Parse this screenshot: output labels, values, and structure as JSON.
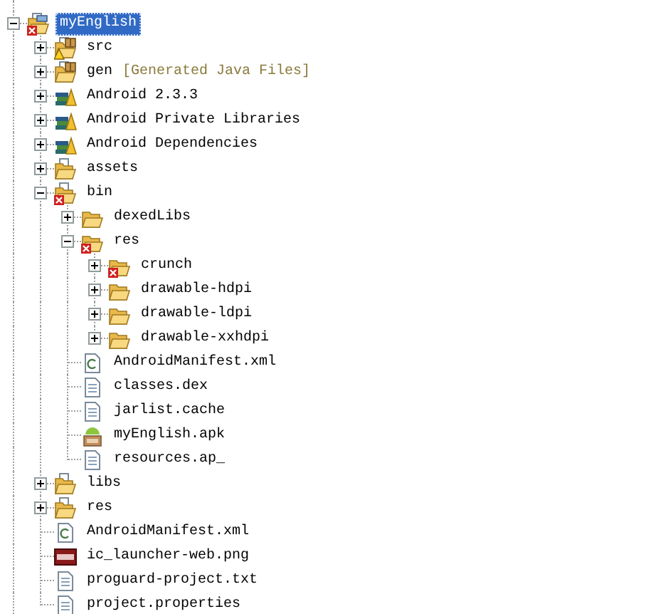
{
  "tree": [
    {
      "label": "myEnglish",
      "kind": "project",
      "error": true,
      "expanded": true,
      "selected": true,
      "children": [
        {
          "label": "src",
          "kind": "source-folder",
          "warning": true,
          "expanded": false,
          "selected": false
        },
        {
          "label": "gen",
          "decoration": "[Generated Java Files]",
          "kind": "source-folder",
          "expanded": false,
          "selected": false
        },
        {
          "label": "Android 2.3.3",
          "kind": "library",
          "expanded": false,
          "selected": false
        },
        {
          "label": "Android Private Libraries",
          "kind": "library",
          "expanded": false,
          "selected": false
        },
        {
          "label": "Android Dependencies",
          "kind": "library",
          "expanded": false,
          "selected": false
        },
        {
          "label": "assets",
          "kind": "linked-folder",
          "expanded": false,
          "selected": false
        },
        {
          "label": "bin",
          "kind": "linked-folder",
          "error": true,
          "expanded": true,
          "selected": false,
          "children": [
            {
              "label": "dexedLibs",
              "kind": "folder",
              "expanded": false,
              "selected": false
            },
            {
              "label": "res",
              "kind": "folder",
              "error": true,
              "expanded": true,
              "selected": false,
              "children": [
                {
                  "label": "crunch",
                  "kind": "folder",
                  "error": true,
                  "expanded": false,
                  "selected": false
                },
                {
                  "label": "drawable-hdpi",
                  "kind": "folder",
                  "expanded": false,
                  "selected": false
                },
                {
                  "label": "drawable-ldpi",
                  "kind": "folder",
                  "expanded": false,
                  "selected": false
                },
                {
                  "label": "drawable-xxhdpi",
                  "kind": "folder",
                  "expanded": false,
                  "selected": false
                }
              ]
            },
            {
              "label": "AndroidManifest.xml",
              "kind": "xml-file",
              "selected": false
            },
            {
              "label": "classes.dex",
              "kind": "text-file",
              "selected": false
            },
            {
              "label": "jarlist.cache",
              "kind": "text-file",
              "selected": false
            },
            {
              "label": "myEnglish.apk",
              "kind": "apk-file",
              "selected": false
            },
            {
              "label": "resources.ap_",
              "kind": "text-file",
              "selected": false
            }
          ]
        },
        {
          "label": "libs",
          "kind": "linked-folder",
          "expanded": false,
          "selected": false
        },
        {
          "label": "res",
          "kind": "linked-folder",
          "expanded": false,
          "selected": false
        },
        {
          "label": "AndroidManifest.xml",
          "kind": "xml-file",
          "selected": false
        },
        {
          "label": "ic_launcher-web.png",
          "kind": "image-file",
          "selected": false
        },
        {
          "label": "proguard-project.txt",
          "kind": "text-file",
          "selected": false
        },
        {
          "label": "project.properties",
          "kind": "text-file",
          "selected": false
        }
      ]
    }
  ]
}
